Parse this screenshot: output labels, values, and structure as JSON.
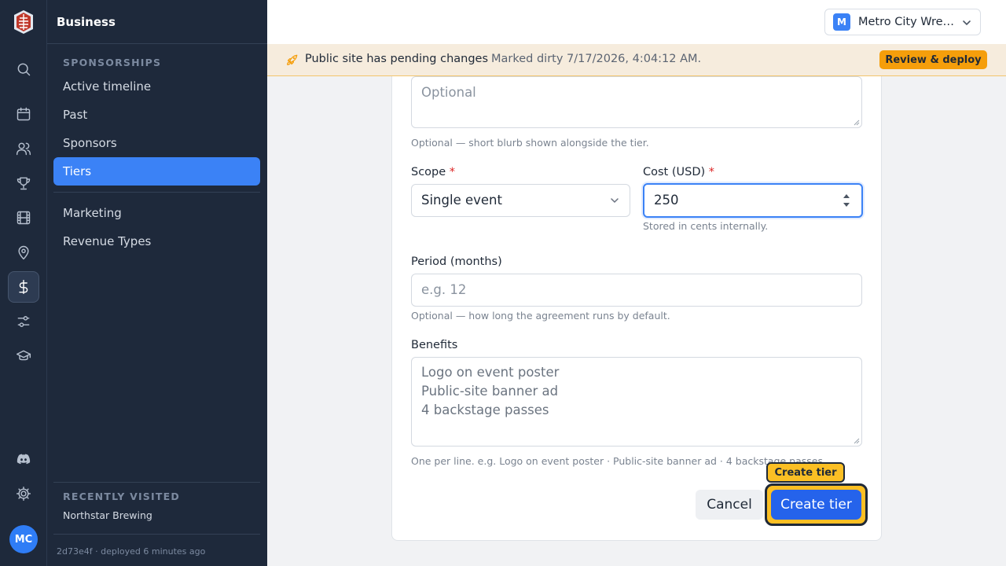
{
  "rail": {
    "avatar_initials": "MC",
    "icons": [
      "search-icon",
      "calendar-icon",
      "users-icon",
      "trophy-icon",
      "film-icon",
      "map-pin-icon",
      "dollar-icon",
      "sliders-icon",
      "graduation-cap-icon",
      "discord-icon",
      "settings-icon"
    ],
    "active_icon": "dollar-icon"
  },
  "sidebar": {
    "title": "Business",
    "group_label": "SPONSORSHIPS",
    "items": [
      {
        "label": "Active timeline"
      },
      {
        "label": "Past"
      },
      {
        "label": "Sponsors"
      },
      {
        "label": "Tiers"
      },
      {
        "label": "Marketing"
      },
      {
        "label": "Revenue Types"
      }
    ],
    "active_item": "Tiers",
    "recent_label": "RECENTLY VISITED",
    "recent_item": "Northstar Brewing",
    "footer": "2d73e4f  · deployed 6 minutes ago"
  },
  "topbar": {
    "org_badge": "M",
    "org_name": "Metro City Wrestling"
  },
  "banner": {
    "message": "Public site has pending changes",
    "detail": "Marked dirty 7/17/2026, 4:04:12 AM.",
    "button": "Review & deploy",
    "accent": "#f59e0b"
  },
  "form": {
    "description": {
      "placeholder": "Optional",
      "hint": "Optional — short blurb shown alongside the tier."
    },
    "scope": {
      "label": "Scope",
      "required_mark": "*",
      "value": "Single event"
    },
    "cost": {
      "label": "Cost (USD)",
      "required_mark": "*",
      "value": "250",
      "hint": "Stored in cents internally."
    },
    "period": {
      "label": "Period (months)",
      "placeholder": "e.g. 12",
      "hint": "Optional — how long the agreement runs by default."
    },
    "benefits": {
      "label": "Benefits",
      "placeholder_lines": [
        "Logo on event poster",
        "Public-site banner ad",
        "4 backstage passes"
      ],
      "hint": "One per line. e.g. Logo on event poster · Public-site banner ad · 4 backstage passes"
    },
    "cancel": "Cancel",
    "submit": "Create tier",
    "tooltip": "Create tier",
    "primary_color": "#2563eb"
  }
}
